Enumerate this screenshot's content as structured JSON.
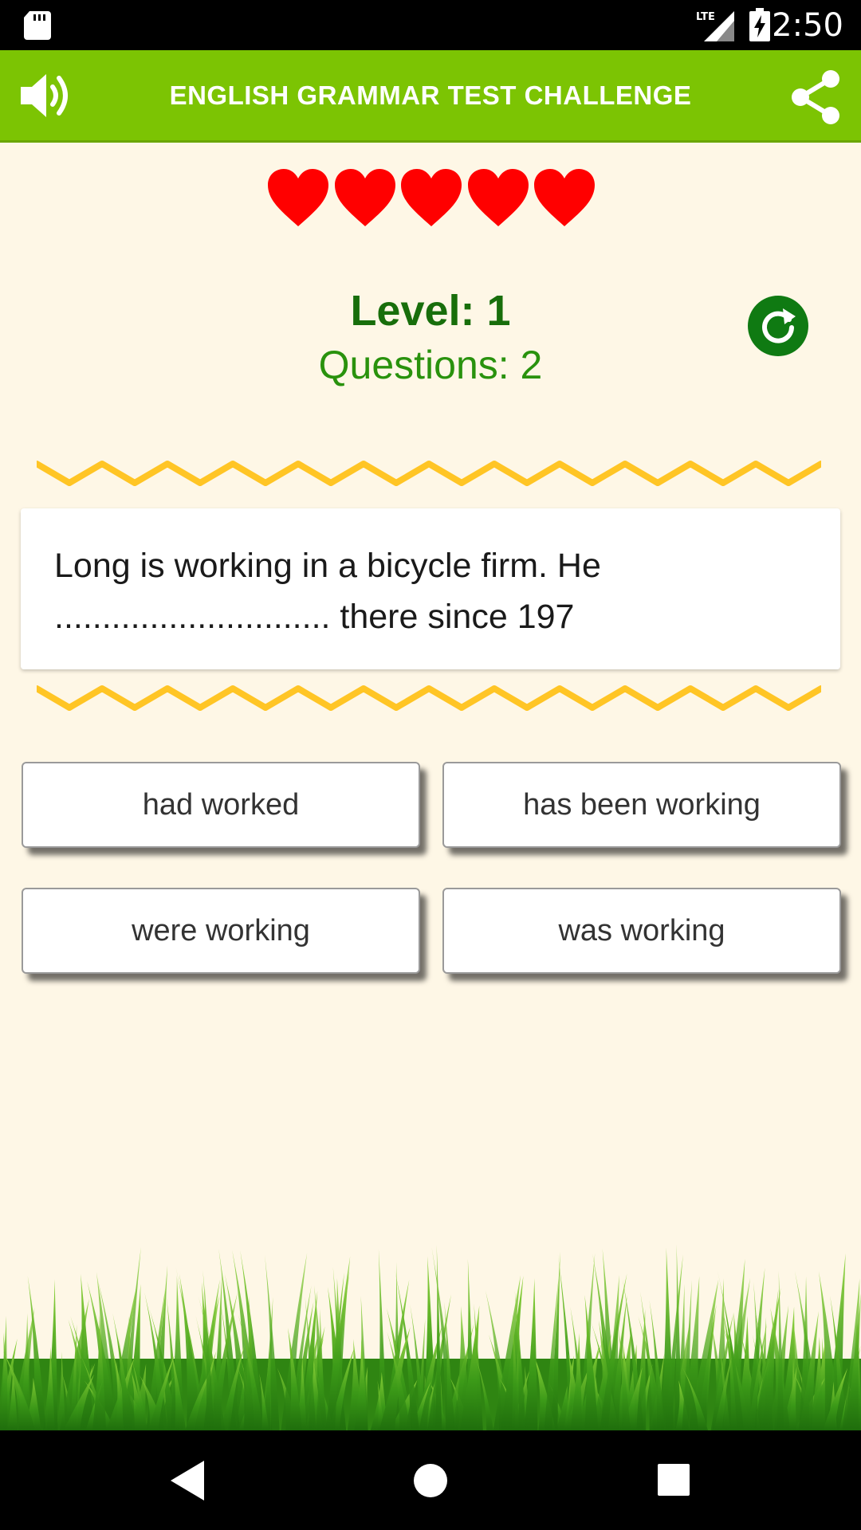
{
  "status_bar": {
    "time": "2:50",
    "network": "LTE",
    "icons": [
      "sd-card-icon",
      "lte-signal-icon",
      "battery-charging-icon"
    ]
  },
  "app_bar": {
    "title": "ENGLISH GRAMMAR TEST CHALLENGE",
    "left_icon": "speaker-icon",
    "right_icon": "share-icon",
    "color": "#7cc403"
  },
  "lives": {
    "remaining": 5,
    "max": 5,
    "icon": "heart-icon",
    "color": "#ff0000"
  },
  "progress": {
    "level_text": "Level: 1",
    "questions_text": "Questions: 2",
    "restart_icon": "restart-icon"
  },
  "question": {
    "line1": "Long is working in a bicycle firm. He",
    "line2": "............................. there since 197"
  },
  "answers": [
    {
      "label": "had worked"
    },
    {
      "label": "has been working"
    },
    {
      "label": "were working"
    },
    {
      "label": "was working"
    }
  ],
  "nav_bar": {
    "buttons": [
      "back-icon",
      "home-icon",
      "recents-icon"
    ]
  },
  "colors": {
    "background": "#fef7e6",
    "level_text": "#186e0b",
    "questions_text": "#29920d",
    "zigzag": "#ffc21a"
  }
}
